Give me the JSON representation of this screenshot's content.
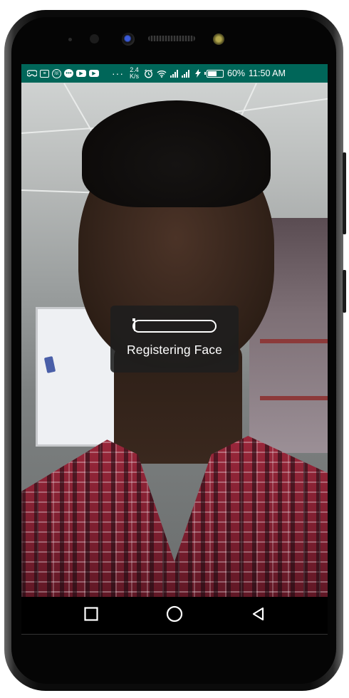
{
  "status_bar": {
    "notification_icons": [
      "gamepad-icon",
      "message-icon",
      "whatsapp-icon",
      "chat-bubble-icon",
      "youtube-icon",
      "youtube-icon"
    ],
    "more": "···",
    "net_speed_value": "2.4",
    "net_speed_unit": "K/s",
    "battery_percent": "60%",
    "battery_level": 0.6,
    "time": "11:50 AM"
  },
  "dialog": {
    "label": "Registering Face",
    "progress": 0.02
  },
  "navigation": {
    "recent_label": "Recent apps",
    "home_label": "Home",
    "back_label": "Back"
  }
}
